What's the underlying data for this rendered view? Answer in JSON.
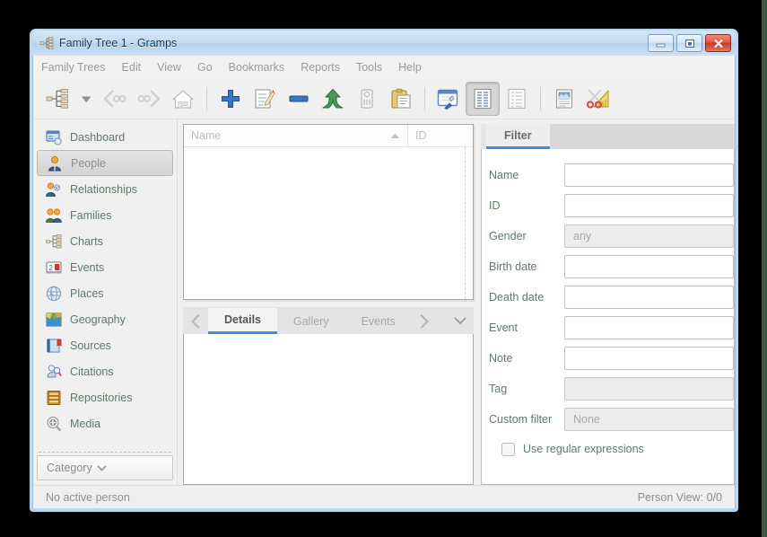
{
  "window": {
    "title": "Family Tree 1 - Gramps",
    "icon": "family-tree-icon",
    "controls": {
      "minimize": "minimize-button",
      "maximize": "maximize-button",
      "close": "close-button"
    }
  },
  "menubar": {
    "items": [
      {
        "label": "Family Trees"
      },
      {
        "label": "Edit"
      },
      {
        "label": "View"
      },
      {
        "label": "Go"
      },
      {
        "label": "Bookmarks"
      },
      {
        "label": "Reports"
      },
      {
        "label": "Tools"
      },
      {
        "label": "Help"
      }
    ]
  },
  "toolbar": {
    "items": [
      {
        "icon": "family-tree-icon",
        "name": "person-tree-button",
        "disabled": false
      },
      {
        "icon": "chevron-down-icon",
        "name": "history-dropdown-button",
        "disabled": false
      },
      {
        "icon": "back-arrow-icon",
        "name": "go-back-button",
        "disabled": true
      },
      {
        "icon": "forward-arrow-icon",
        "name": "go-forward-button",
        "disabled": true
      },
      {
        "icon": "home-icon",
        "name": "home-person-button",
        "disabled": false
      },
      {
        "icon": "separator",
        "name": "toolbar-separator-1",
        "disabled": false
      },
      {
        "icon": "plus-icon",
        "name": "add-person-button",
        "disabled": false
      },
      {
        "icon": "edit-note-icon",
        "name": "edit-person-button",
        "disabled": false
      },
      {
        "icon": "minus-icon",
        "name": "remove-person-button",
        "disabled": false
      },
      {
        "icon": "merge-arrow-icon",
        "name": "merge-button",
        "disabled": false
      },
      {
        "icon": "tag-icon",
        "name": "tag-button",
        "disabled": true
      },
      {
        "icon": "clipboard-icon",
        "name": "clipboard-button",
        "disabled": false
      },
      {
        "icon": "separator",
        "name": "toolbar-separator-2",
        "disabled": false
      },
      {
        "icon": "configure-view-icon",
        "name": "configure-view-button",
        "disabled": false
      },
      {
        "icon": "list-view-icon",
        "name": "grouped-people-view-button",
        "disabled": false,
        "pressed": true
      },
      {
        "icon": "flat-list-icon",
        "name": "person-list-view-button",
        "disabled": false
      },
      {
        "icon": "separator",
        "name": "toolbar-separator-3",
        "disabled": false
      },
      {
        "icon": "report-icon",
        "name": "reports-button",
        "disabled": false
      },
      {
        "icon": "scissors-ruler-icon",
        "name": "tools-button",
        "disabled": false
      }
    ]
  },
  "sidebar": {
    "items": [
      {
        "label": "Dashboard",
        "icon": "dashboard-icon",
        "active": false
      },
      {
        "label": "People",
        "icon": "person-icon",
        "active": true
      },
      {
        "label": "Relationships",
        "icon": "relationships-icon",
        "active": false
      },
      {
        "label": "Families",
        "icon": "families-icon",
        "active": false
      },
      {
        "label": "Charts",
        "icon": "charts-icon",
        "active": false
      },
      {
        "label": "Events",
        "icon": "events-icon",
        "active": false
      },
      {
        "label": "Places",
        "icon": "places-globe-icon",
        "active": false
      },
      {
        "label": "Geography",
        "icon": "geography-map-icon",
        "active": false
      },
      {
        "label": "Sources",
        "icon": "sources-book-icon",
        "active": false
      },
      {
        "label": "Citations",
        "icon": "citations-icon",
        "active": false
      },
      {
        "label": "Repositories",
        "icon": "repositories-icon",
        "active": false
      },
      {
        "label": "Media",
        "icon": "media-icon",
        "active": false
      }
    ],
    "category": {
      "label": "Category",
      "chevron": "chevron-down-icon"
    }
  },
  "list_view": {
    "columns": [
      {
        "label": "Name",
        "sort": "ascending"
      },
      {
        "label": "ID",
        "sort": "none"
      }
    ],
    "rows": []
  },
  "bottom_tabs": {
    "prev_arrow": "chevron-left-icon",
    "next_arrow": "chevron-right-icon",
    "menu_chevron": "chevron-down-icon",
    "items": [
      {
        "label": "Details",
        "active": true
      },
      {
        "label": "Gallery",
        "active": false
      },
      {
        "label": "Events",
        "active": false
      }
    ]
  },
  "filter_panel": {
    "tab": {
      "label": "Filter",
      "active": true
    },
    "fields": [
      {
        "label": "Name",
        "value": "",
        "type": "text"
      },
      {
        "label": "ID",
        "value": "",
        "type": "text"
      },
      {
        "label": "Gender",
        "value": "any",
        "type": "combo"
      },
      {
        "label": "Birth date",
        "value": "",
        "type": "text"
      },
      {
        "label": "Death date",
        "value": "",
        "type": "text"
      },
      {
        "label": "Event",
        "value": "",
        "type": "text"
      },
      {
        "label": "Note",
        "value": "",
        "type": "text"
      },
      {
        "label": "Tag",
        "value": "",
        "type": "combo"
      },
      {
        "label": "Custom filter",
        "value": "None",
        "type": "combo"
      }
    ],
    "checkbox": {
      "label": "Use regular expressions",
      "checked": false
    }
  },
  "statusbar": {
    "left": "No active person",
    "right": "Person View: 0/0"
  },
  "colors": {
    "accent": "#3d8fd4",
    "frame": "#b9d8ef",
    "label_green": "#5f7a66",
    "close_red": "#c83b26"
  }
}
